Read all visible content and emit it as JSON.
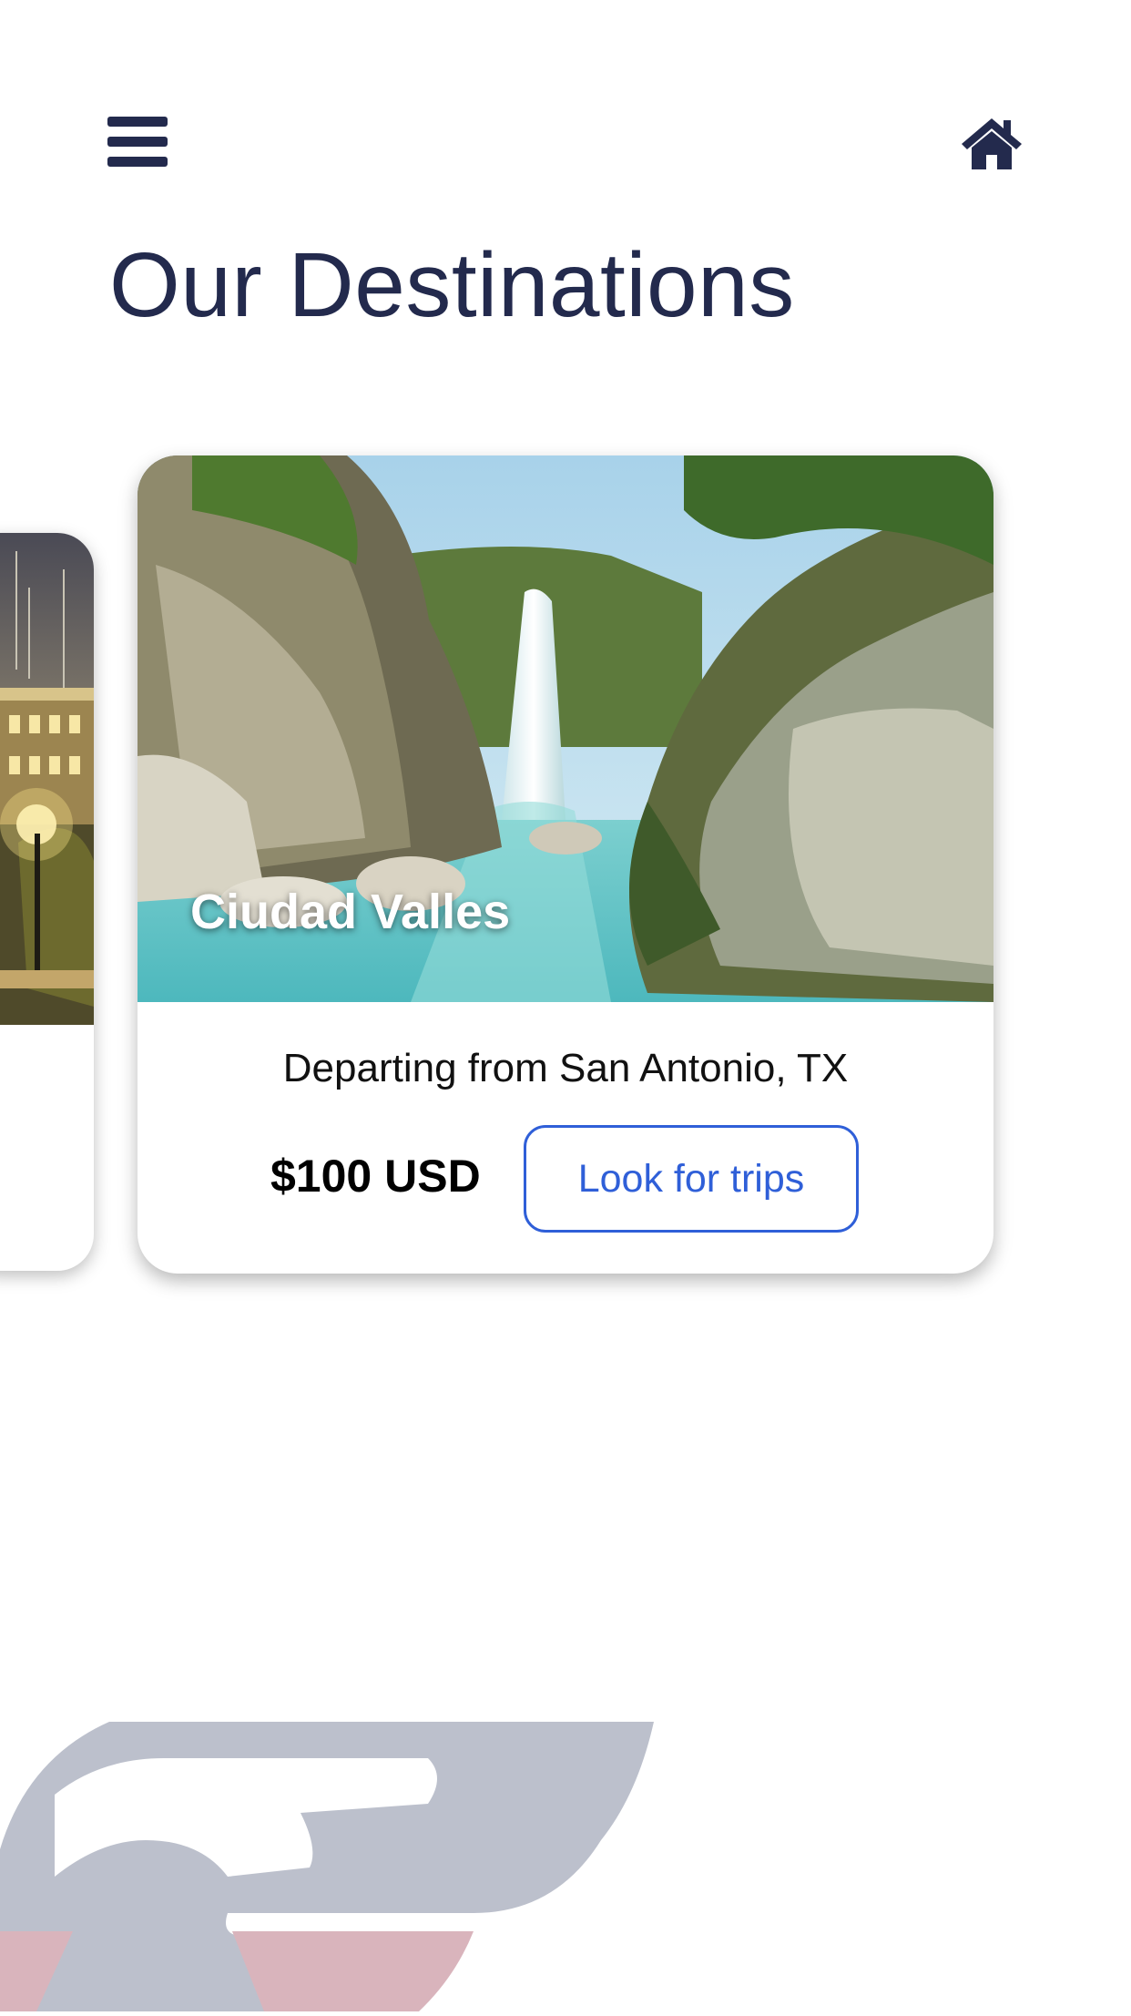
{
  "header": {
    "menu_icon": "hamburger-menu-icon",
    "home_icon": "home-icon",
    "title": "Our Destinations"
  },
  "destinations": [
    {
      "name": "Ciudad Valles",
      "departing": "Departing from San Antonio, TX",
      "price": "$100 USD",
      "action_label": "Look for trips",
      "image": "waterfall-canyon-photo"
    }
  ],
  "colors": {
    "navy": "#232a4d",
    "accent_blue": "#2f5fd8",
    "watermark_gray": "#bcc0cc",
    "watermark_red": "#d9b4bc"
  }
}
